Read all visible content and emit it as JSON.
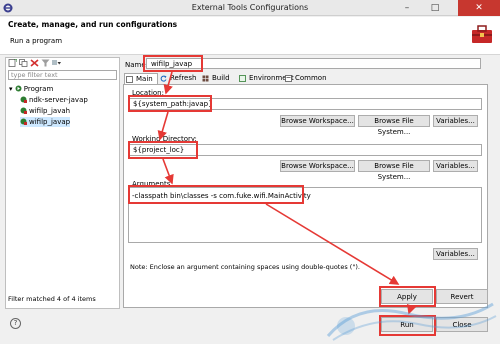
{
  "window": {
    "title": "External Tools Configurations",
    "minimize_label": "–",
    "maximize_label": "□",
    "close_label": "✕"
  },
  "header": {
    "title": "Create, manage, and run configurations",
    "subtitle": "Run a program",
    "icon": "toolbox-icon"
  },
  "left_panel": {
    "toolbar_icons": [
      "new-config-icon",
      "duplicate-icon",
      "delete-icon",
      "filter-icon",
      "view-menu-icon"
    ],
    "filter_placeholder": "type filter text",
    "tree": {
      "root": "Program",
      "items": [
        "ndk-server-javap",
        "wifilp_javah",
        "wifilp_javap"
      ]
    },
    "status": "Filter matched 4 of 4 items"
  },
  "config": {
    "name_label": "Name:",
    "name_value": "wifilp_javap",
    "tabs": [
      "Main",
      "Refresh",
      "Build",
      "Environment",
      "Common"
    ],
    "location": {
      "label": "Location:",
      "value": "${system_path:javap}",
      "buttons": [
        "Browse Workspace...",
        "Browse File System...",
        "Variables..."
      ]
    },
    "working_directory": {
      "label": "Working Directory:",
      "value": "${project_loc}",
      "buttons": [
        "Browse Workspace...",
        "Browse File System...",
        "Variables..."
      ]
    },
    "arguments": {
      "label": "Arguments:",
      "value": "-classpath bin\\classes -s com.fuke.wifi.MainActivity",
      "variables_button": "Variables..."
    },
    "note": "Note: Enclose an argument containing spaces using double-quotes (\")."
  },
  "actions": {
    "apply": "Apply",
    "revert": "Revert",
    "run": "Run",
    "close": "Close"
  },
  "colors": {
    "annotation_red": "#e53935",
    "active_tab_bg": "#ffffff",
    "selected_tree_bg": "#cde8ff"
  }
}
